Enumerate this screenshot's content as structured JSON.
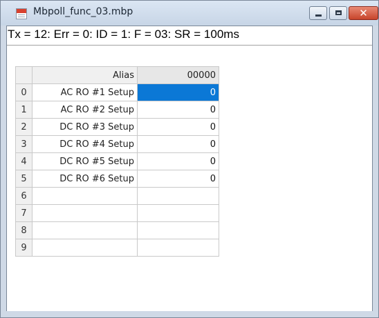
{
  "window": {
    "title": "Mbpoll_func_03.mbp"
  },
  "status_line": "Tx = 12: Err = 0: ID = 1: F = 03: SR = 100ms",
  "grid": {
    "columns": [
      "Alias",
      "00000"
    ],
    "rows": [
      {
        "index": "0",
        "alias": "AC RO #1 Setup",
        "value": "0"
      },
      {
        "index": "1",
        "alias": "AC RO #2 Setup",
        "value": "0"
      },
      {
        "index": "2",
        "alias": "DC RO #3 Setup",
        "value": "0"
      },
      {
        "index": "3",
        "alias": "DC RO #4 Setup",
        "value": "0"
      },
      {
        "index": "4",
        "alias": "DC RO #5 Setup",
        "value": "0"
      },
      {
        "index": "5",
        "alias": "DC RO #6 Setup",
        "value": "0"
      },
      {
        "index": "6",
        "alias": "",
        "value": ""
      },
      {
        "index": "7",
        "alias": "",
        "value": ""
      },
      {
        "index": "8",
        "alias": "",
        "value": ""
      },
      {
        "index": "9",
        "alias": "",
        "value": ""
      }
    ],
    "selected_row": 0
  },
  "colors": {
    "selection": "#0b78d6",
    "close_button": "#c7442b"
  }
}
